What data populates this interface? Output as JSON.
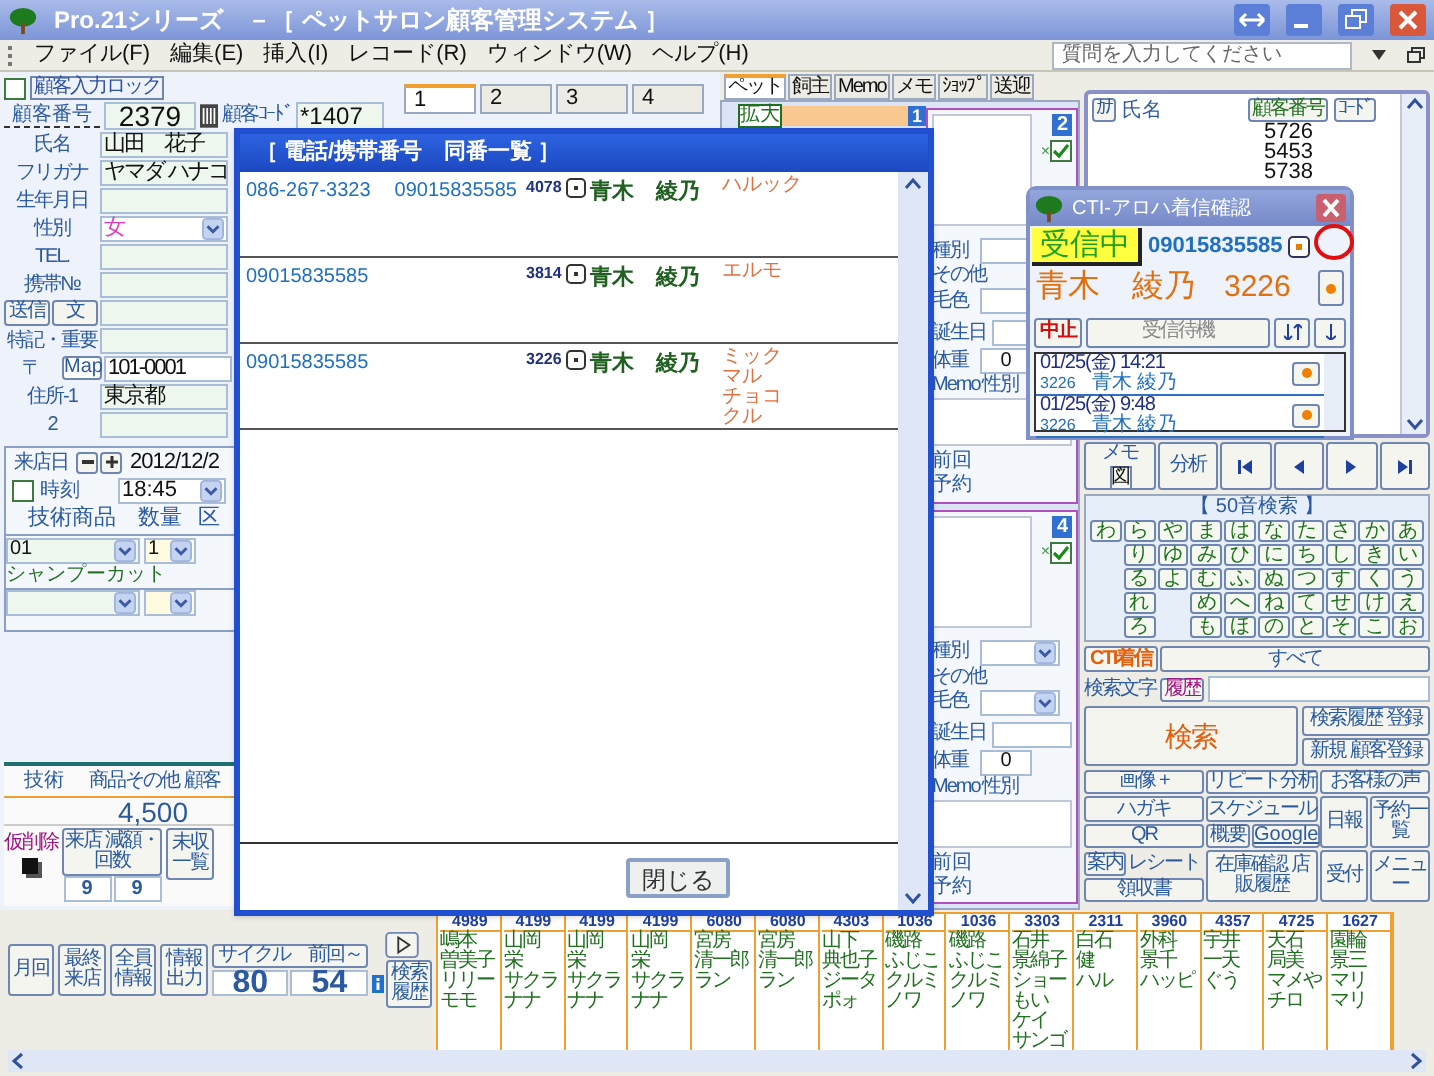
{
  "window": {
    "title": "Pro.21シリーズ　－［ ペットサロン顧客管理システム ］"
  },
  "menu": [
    "ファイル(F)",
    "編集(E)",
    "挿入(I)",
    "レコード(R)",
    "ウィンドウ(W)",
    "ヘルプ(H)"
  ],
  "help_search": {
    "placeholder": "質問を入力してください"
  },
  "customer": {
    "lock": {
      "label": "顧客入力ロック",
      "checked": false
    },
    "number_label": "顧客番号",
    "number": "2379",
    "code_label": "顧客ｺｰﾄﾞ",
    "code": "*1407",
    "rows": [
      {
        "kind": "text",
        "label": "氏名",
        "value": "山田　花子"
      },
      {
        "kind": "text",
        "label": "フリガナ",
        "value": "ヤマダ ハナコ"
      },
      {
        "kind": "text",
        "label": "生年月日"
      },
      {
        "kind": "select",
        "label": "性別",
        "value": "女"
      },
      {
        "kind": "text",
        "label": "TEL."
      },
      {
        "kind": "text",
        "label": "携帯№"
      },
      {
        "kind": "buttons",
        "buttons": [
          "送信",
          "文"
        ]
      },
      {
        "kind": "text",
        "label": "特記・重要"
      },
      {
        "kind": "map",
        "label": "〒",
        "button": "Map",
        "value": "101-0001"
      },
      {
        "kind": "text",
        "label": "住所-1",
        "value": "東京都"
      },
      {
        "kind": "text",
        "label": "2"
      }
    ]
  },
  "record_tabs": [
    {
      "label": "1",
      "selected": true
    },
    {
      "label": "2",
      "selected": false
    },
    {
      "label": "3",
      "selected": false
    },
    {
      "label": "4",
      "selected": false
    }
  ],
  "visit": {
    "date_label": "来店日",
    "date": "2012/12/2",
    "time_label": "時刻",
    "time": "18:45",
    "checked": false,
    "columns": [
      "技術商品",
      "数量",
      "区"
    ],
    "items": [
      {
        "code": "01",
        "qty": "1",
        "name": "シャンプーカット"
      }
    ]
  },
  "totals": {
    "columns": [
      "技術",
      "商品その他",
      "顧客"
    ],
    "amount": "4,500",
    "delete_label": "仮削除",
    "visit_button": "来店 減額・回数",
    "counts": [
      "9",
      "9"
    ],
    "unpaid_button": "未収一覧"
  },
  "bottom": {
    "buttons": [
      "月回",
      "最終来店",
      "全員情報",
      "情報出力"
    ],
    "cycle": {
      "label": "サイクル　前回～",
      "values": [
        "80",
        "54"
      ]
    },
    "history_button": "検索履歴"
  },
  "cards": [
    {
      "code": "4989",
      "lines": [
        "嶋本",
        "曽美子",
        "リリー",
        "モモ"
      ]
    },
    {
      "code": "4199",
      "lines": [
        "山岡",
        "栄",
        "サクラ",
        "ナナ"
      ]
    },
    {
      "code": "4199",
      "lines": [
        "山岡",
        "栄",
        "サクラ",
        "ナナ"
      ]
    },
    {
      "code": "4199",
      "lines": [
        "山岡",
        "栄",
        "サクラ",
        "ナナ"
      ]
    },
    {
      "code": "6080",
      "lines": [
        "宮房",
        "清一郎",
        "ラン"
      ]
    },
    {
      "code": "6080",
      "lines": [
        "宮房",
        "清一郎",
        "ラン"
      ]
    },
    {
      "code": "4303",
      "lines": [
        "山下",
        "典也子",
        "ジータ",
        "ポォ"
      ]
    },
    {
      "code": "1036",
      "lines": [
        "磯路",
        "ふじこ",
        "クルミ",
        "ノワ"
      ]
    },
    {
      "code": "1036",
      "lines": [
        "磯路",
        "ふじこ",
        "クルミ",
        "ノワ"
      ]
    },
    {
      "code": "3303",
      "lines": [
        "石井",
        "景綿子",
        "ショー",
        "もい",
        "ケイ",
        "サンゴ"
      ]
    },
    {
      "code": "2311",
      "lines": [
        "白石",
        "健",
        "ハル"
      ]
    },
    {
      "code": "3960",
      "lines": [
        "外科",
        "景千",
        "ハッピ"
      ]
    },
    {
      "code": "4357",
      "lines": [
        "宇井",
        "一天",
        "ぐう"
      ]
    },
    {
      "code": "4725",
      "lines": [
        "天石",
        "局美",
        "マメや",
        "チロ"
      ]
    },
    {
      "code": "1627",
      "lines": [
        "園輪",
        "景三",
        "マリ",
        "マリ"
      ]
    }
  ],
  "pet_tabs": [
    {
      "label": "ペット",
      "selected": true
    },
    {
      "label": "飼主",
      "selected": false
    },
    {
      "label": "Memo",
      "selected": false
    },
    {
      "label": "メモ",
      "selected": false
    },
    {
      "label": "ｼｮｯﾌﾟ",
      "selected": false
    },
    {
      "label": "送迎",
      "selected": false
    }
  ],
  "pets": {
    "expand": "拡大",
    "first_number": "1",
    "blocks": [
      {
        "number": "2",
        "remove": "×",
        "checked": true,
        "fields": [
          "種別",
          "その他",
          "毛色",
          "誕生日",
          "体重",
          "Memo",
          "性別"
        ],
        "weight": "0",
        "previous": "前回",
        "reservation": "予約"
      },
      {
        "number": "4",
        "remove": "×",
        "checked": true,
        "fields": [
          "種別",
          "その他",
          "毛色",
          "誕生日",
          "体重",
          "Memo",
          "性別"
        ],
        "weight": "0",
        "previous": "前回",
        "reservation": "予約"
      }
    ]
  },
  "customer_list": {
    "kana_button": "ｶﾅ",
    "name_header": "氏名",
    "number_button": "顧客番号",
    "code_button": "ｺｰﾄﾞ",
    "codes": [
      "5726",
      "5453",
      "5738"
    ]
  },
  "nav": {
    "memo": "メモ",
    "memo_icon": "図",
    "analysis": "分析"
  },
  "kana_search": {
    "title": "【 50音検索 】",
    "rows": [
      [
        {
          "kind": "key",
          "char": "わ"
        },
        {
          "kind": "key",
          "char": "ら"
        },
        {
          "kind": "key",
          "char": "や"
        },
        {
          "kind": "key",
          "char": "ま"
        },
        {
          "kind": "key",
          "char": "は"
        },
        {
          "kind": "key",
          "char": "な"
        },
        {
          "kind": "key",
          "char": "た"
        },
        {
          "kind": "key",
          "char": "さ"
        },
        {
          "kind": "key",
          "char": "か"
        },
        {
          "kind": "key",
          "char": "あ"
        }
      ],
      [
        {
          "kind": "gap"
        },
        {
          "kind": "key",
          "char": "り"
        },
        {
          "kind": "key",
          "char": "ゆ"
        },
        {
          "kind": "key",
          "char": "み"
        },
        {
          "kind": "key",
          "char": "ひ"
        },
        {
          "kind": "key",
          "char": "に"
        },
        {
          "kind": "key",
          "char": "ち"
        },
        {
          "kind": "key",
          "char": "し"
        },
        {
          "kind": "key",
          "char": "き"
        },
        {
          "kind": "key",
          "char": "い"
        }
      ],
      [
        {
          "kind": "gap"
        },
        {
          "kind": "key",
          "char": "る"
        },
        {
          "kind": "key",
          "char": "よ"
        },
        {
          "kind": "key",
          "char": "む"
        },
        {
          "kind": "key",
          "char": "ふ"
        },
        {
          "kind": "key",
          "char": "ぬ"
        },
        {
          "kind": "key",
          "char": "つ"
        },
        {
          "kind": "key",
          "char": "す"
        },
        {
          "kind": "key",
          "char": "く"
        },
        {
          "kind": "key",
          "char": "う"
        }
      ],
      [
        {
          "kind": "gap"
        },
        {
          "kind": "key",
          "char": "れ"
        },
        {
          "kind": "gap"
        },
        {
          "kind": "key",
          "char": "め"
        },
        {
          "kind": "key",
          "char": "へ"
        },
        {
          "kind": "key",
          "char": "ね"
        },
        {
          "kind": "key",
          "char": "て"
        },
        {
          "kind": "key",
          "char": "せ"
        },
        {
          "kind": "key",
          "char": "け"
        },
        {
          "kind": "key",
          "char": "え"
        }
      ],
      [
        {
          "kind": "gap"
        },
        {
          "kind": "key",
          "char": "ろ"
        },
        {
          "kind": "gap"
        },
        {
          "kind": "key",
          "char": "も"
        },
        {
          "kind": "key",
          "char": "ほ"
        },
        {
          "kind": "key",
          "char": "の"
        },
        {
          "kind": "key",
          "char": "と"
        },
        {
          "kind": "key",
          "char": "そ"
        },
        {
          "kind": "key",
          "char": "こ"
        },
        {
          "kind": "key",
          "char": "お"
        }
      ]
    ]
  },
  "actions": {
    "cti": "CTI着信",
    "all": "すべて",
    "search_label": "検索文字",
    "history": "履歴",
    "search": "検索",
    "history_register": "検索履歴 登録",
    "new_customer": "新規 顧客登録"
  },
  "tools": {
    "image": "画像 +",
    "repeat": "リピート分析",
    "voice": "お客様の声",
    "postcard": "ハガキ",
    "schedule": "スケジュール",
    "daily": "日報",
    "reservations": "予約一覧",
    "qr": "QR",
    "overview": "概要",
    "google": "Google",
    "guide": "案内",
    "receipt": "レシート",
    "stock": "在庫確認 店販履歴",
    "reception": "受付",
    "menu": "メニュー",
    "invoice": "領収書"
  },
  "same_number_dialog": {
    "title": "［ 電話/携帯番号　同番一覧 ］",
    "close": "閉じる",
    "rows": [
      {
        "phones": [
          "086-267-3323",
          "09015835585"
        ],
        "code": "4078",
        "name": "青木　綾乃",
        "pets": [
          "ハルック"
        ]
      },
      {
        "phones": [
          "09015835585"
        ],
        "code": "3814",
        "name": "青木　綾乃",
        "pets": [
          "エルモ"
        ]
      },
      {
        "phones": [
          "09015835585"
        ],
        "code": "3226",
        "name": "青木　綾乃",
        "pets": [
          "ミック",
          "マル",
          "チョコ",
          "クル"
        ]
      }
    ]
  },
  "cti_dialog": {
    "title": "CTI-アロハ着信確認",
    "status": "受信中",
    "phone": "09015835585",
    "name": "青木　綾乃",
    "code": "3226",
    "stop": "中止",
    "waiting": "受信待機",
    "history": [
      {
        "time": "01/25(金) 14:21",
        "code": "3226",
        "name": "青木 綾乃"
      },
      {
        "time": "01/25(金) 9:48",
        "code": "3226",
        "name": "青木 綾乃"
      }
    ]
  }
}
